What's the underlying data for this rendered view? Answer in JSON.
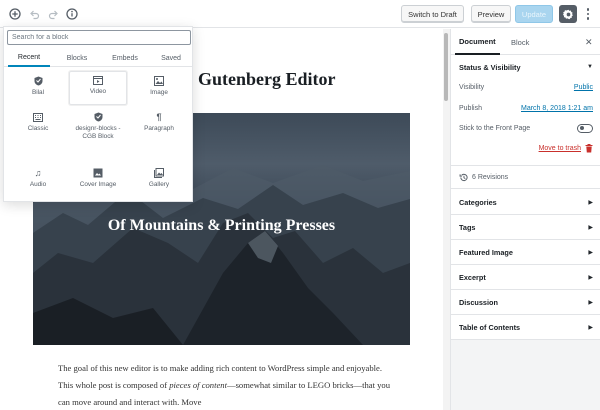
{
  "toolbar": {
    "add_icon": "plus-circle-icon",
    "undo_icon": "undo-icon",
    "redo_icon": "redo-icon",
    "info_icon": "info-icon",
    "switch_to_draft": "Switch to Draft",
    "preview": "Preview",
    "update": "Update",
    "settings_icon": "gear-icon",
    "more_icon": "more-vertical-icon",
    "accent": "#0085ba"
  },
  "editor": {
    "title": "Gutenberg Editor",
    "cover_title": "Of Mountains & Printing Presses",
    "paragraph_1": "The goal of this new editor is to make adding rich content to WordPress simple and enjoyable. This whole post is composed of ",
    "paragraph_em": "pieces of content",
    "paragraph_2": "—somewhat similar to LEGO bricks—that you can move around and interact with. Move"
  },
  "inserter": {
    "search_placeholder": "Search for a block",
    "tabs": [
      {
        "label": "Recent"
      },
      {
        "label": "Blocks"
      },
      {
        "label": "Embeds"
      },
      {
        "label": "Saved"
      }
    ],
    "blocks": [
      {
        "label": "Bilal",
        "icon": "shield-icon"
      },
      {
        "label": "Video",
        "icon": "video-icon"
      },
      {
        "label": "Image",
        "icon": "image-icon"
      },
      {
        "label": "Classic",
        "icon": "keyboard-icon"
      },
      {
        "label": "designr-blocks - CGB Block",
        "icon": "shield-icon"
      },
      {
        "label": "Paragraph",
        "icon": "paragraph-icon"
      },
      {
        "label": "Audio",
        "icon": "music-note-icon"
      },
      {
        "label": "Cover Image",
        "icon": "cover-image-icon"
      },
      {
        "label": "Gallery",
        "icon": "gallery-icon"
      }
    ]
  },
  "sidebar": {
    "tab_document": "Document",
    "tab_block": "Block",
    "close_icon": "close-icon",
    "status_title": "Status & Visibility",
    "visibility_label": "Visibility",
    "visibility_value": "Public",
    "publish_label": "Publish",
    "publish_value": "March 8, 2018 1:21 am",
    "sticky_label": "Stick to the Front Page",
    "trash_label": "Move to trash",
    "trash_color": "#c9302c",
    "revisions": "6 Revisions",
    "sections": [
      {
        "label": "Categories"
      },
      {
        "label": "Tags"
      },
      {
        "label": "Featured Image"
      },
      {
        "label": "Excerpt"
      },
      {
        "label": "Discussion"
      },
      {
        "label": "Table of Contents"
      }
    ]
  }
}
